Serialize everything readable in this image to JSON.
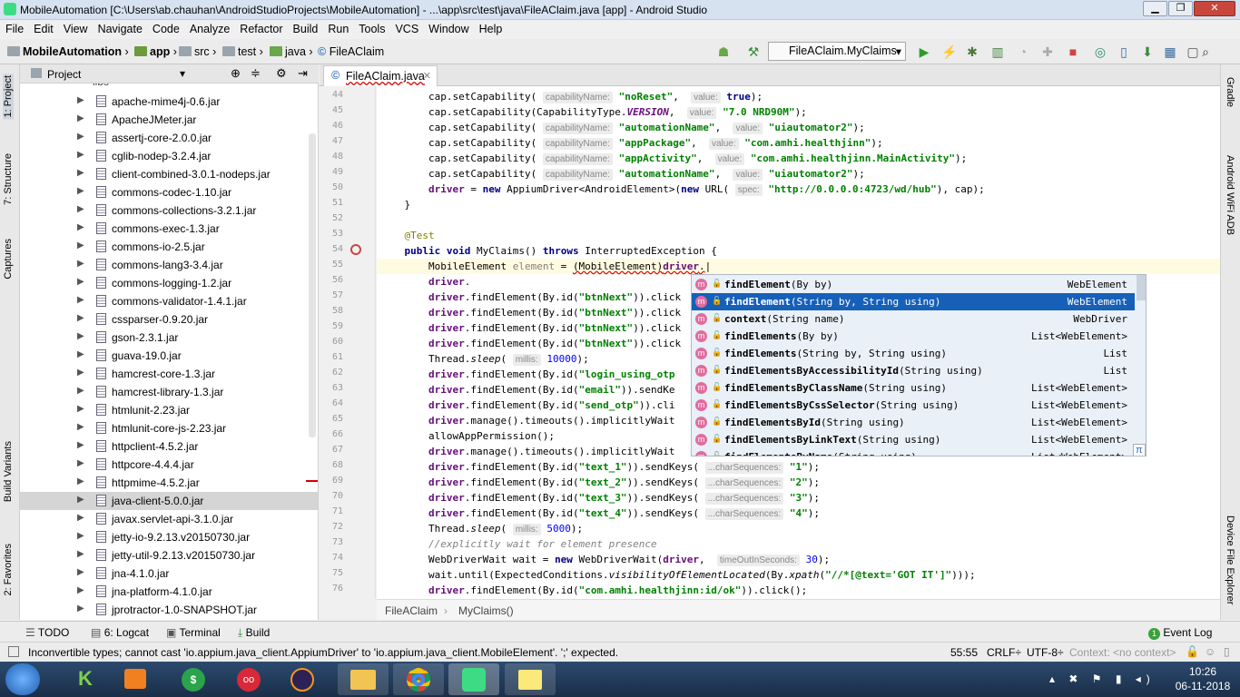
{
  "window": {
    "title": "MobileAutomation [C:\\Users\\ab.chauhan\\AndroidStudioProjects\\MobileAutomation] - ...\\app\\src\\test\\java\\FileAClaim.java [app] - Android Studio"
  },
  "menu": [
    "File",
    "Edit",
    "View",
    "Navigate",
    "Code",
    "Analyze",
    "Refactor",
    "Build",
    "Run",
    "Tools",
    "VCS",
    "Window",
    "Help"
  ],
  "breadcrumb": {
    "project": "MobileAutomation",
    "module": "app",
    "src": "src",
    "test": "test",
    "java": "java",
    "file": "FileAClaim"
  },
  "run_config": "FileAClaim.MyClaims",
  "left_tabs": {
    "project": "1: Project",
    "structure": "7: Structure",
    "captures": "Captures",
    "build_variants": "Build Variants",
    "favorites": "2: Favorites"
  },
  "right_tabs": {
    "gradle": "Gradle",
    "wifi_adb": "Android WiFi ADB",
    "device_explorer": "Device File Explorer"
  },
  "project_panel": {
    "title": "Project",
    "items": [
      "apache-mime4j-0.6.jar",
      "ApacheJMeter.jar",
      "assertj-core-2.0.0.jar",
      "cglib-nodep-3.2.4.jar",
      "client-combined-3.0.1-nodeps.jar",
      "commons-codec-1.10.jar",
      "commons-collections-3.2.1.jar",
      "commons-exec-1.3.jar",
      "commons-io-2.5.jar",
      "commons-lang3-3.4.jar",
      "commons-logging-1.2.jar",
      "commons-validator-1.4.1.jar",
      "cssparser-0.9.20.jar",
      "gson-2.3.1.jar",
      "guava-19.0.jar",
      "hamcrest-core-1.3.jar",
      "hamcrest-library-1.3.jar",
      "htmlunit-2.23.jar",
      "htmlunit-core-js-2.23.jar",
      "httpclient-4.5.2.jar",
      "httpcore-4.4.4.jar",
      "httpmime-4.5.2.jar",
      "java-client-5.0.0.jar",
      "javax.servlet-api-3.1.0.jar",
      "jetty-io-9.2.13.v20150730.jar",
      "jetty-util-9.2.13.v20150730.jar",
      "jna-4.1.0.jar",
      "jna-platform-4.1.0.jar",
      "jprotractor-1.0-SNAPSHOT.jar"
    ],
    "selected_index": 22
  },
  "editor": {
    "tab": "FileAClaim.java",
    "line_numbers": [
      "44",
      "45",
      "46",
      "47",
      "48",
      "49",
      "50",
      "51",
      "52",
      "53",
      "54",
      "55",
      "56",
      "57",
      "58",
      "59",
      "60",
      "61",
      "62",
      "63",
      "64",
      "65",
      "66",
      "67",
      "68",
      "69",
      "70",
      "71",
      "72",
      "73",
      "74",
      "75",
      "76"
    ],
    "breadcrumb": [
      "FileAClaim",
      "MyClaims()"
    ]
  },
  "completion": {
    "items": [
      {
        "name": "findElement",
        "params": "(By by)",
        "type": "WebElement"
      },
      {
        "name": "findElement",
        "params": "(String by, String using)",
        "type": "WebElement"
      },
      {
        "name": "context",
        "params": "(String name)",
        "type": "WebDriver"
      },
      {
        "name": "findElements",
        "params": "(By by)",
        "type": "List<WebElement>"
      },
      {
        "name": "findElements",
        "params": "(String by, String using)",
        "type": "List"
      },
      {
        "name": "findElementsByAccessibilityId",
        "params": "(String using)",
        "type": "List"
      },
      {
        "name": "findElementsByClassName",
        "params": "(String using)",
        "type": "List<WebElement>"
      },
      {
        "name": "findElementsByCssSelector",
        "params": "(String using)",
        "type": "List<WebElement>"
      },
      {
        "name": "findElementsById",
        "params": "(String using)",
        "type": "List<WebElement>"
      },
      {
        "name": "findElementsByLinkText",
        "params": "(String using)",
        "type": "List<WebElement>"
      },
      {
        "name": "findElementsByName",
        "params": "(String using)",
        "type": "List<WebElement>"
      }
    ],
    "selected_index": 1,
    "pi": "π",
    "icon": "m"
  },
  "bottom_tabs": {
    "todo": "TODO",
    "logcat": "6: Logcat",
    "terminal": "Terminal",
    "build": "Build",
    "event_log": "Event Log",
    "event_count": "1"
  },
  "status": {
    "message": "Inconvertible types; cannot cast 'io.appium.java_client.AppiumDriver' to 'io.appium.java_client.MobileElement'. ';' expected.",
    "position": "55:55",
    "line_sep": "CRLF÷",
    "encoding": "UTF-8÷",
    "context": "Context: <no context>"
  },
  "clock": {
    "time": "10:26",
    "date": "06-11-2018"
  }
}
